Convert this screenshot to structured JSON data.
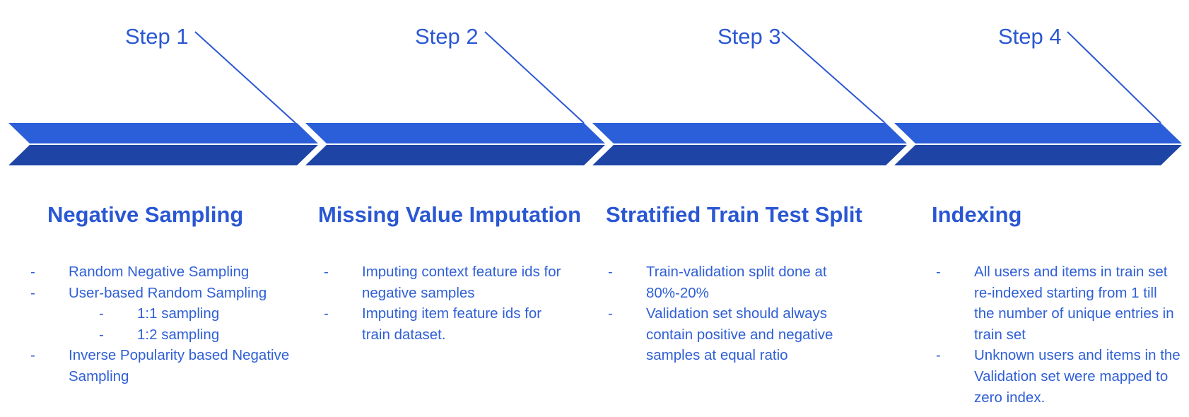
{
  "steps": [
    {
      "step_label": "Step 1",
      "heading": "Negative Sampling",
      "bullets": [
        {
          "text": "Random Negative Sampling",
          "level": 1
        },
        {
          "text": "User-based Random Sampling",
          "level": 1
        },
        {
          "text": "1:1 sampling",
          "level": 2
        },
        {
          "text": "1:2 sampling",
          "level": 2
        },
        {
          "text": "Inverse Popularity based Negative Sampling",
          "level": 1
        }
      ]
    },
    {
      "step_label": "Step 2",
      "heading": "Missing Value Imputation",
      "bullets": [
        {
          "text": "Imputing context feature ids for negative samples",
          "level": 1
        },
        {
          "text": "Imputing item feature ids for train dataset.",
          "level": 1
        }
      ]
    },
    {
      "step_label": "Step 3",
      "heading": "Stratified Train Test Split",
      "bullets": [
        {
          "text": "Train-validation split done at 80%-20%",
          "level": 1
        },
        {
          "text": "Validation set should always contain positive and negative samples at equal ratio",
          "level": 1
        }
      ]
    },
    {
      "step_label": "Step 4",
      "heading": "Indexing",
      "bullets": [
        {
          "text": "All users and items in train set re-indexed starting from 1 till the number of unique entries in train set",
          "level": 1
        },
        {
          "text": "Unknown users and items in the Validation set were mapped to zero index.",
          "level": 1
        }
      ]
    }
  ],
  "bullet_marker": "-",
  "colors": {
    "text": "#2a57d3",
    "arrow_top": "#2b5fd9",
    "arrow_bottom": "#1e45a6",
    "background": "#ffffff"
  }
}
